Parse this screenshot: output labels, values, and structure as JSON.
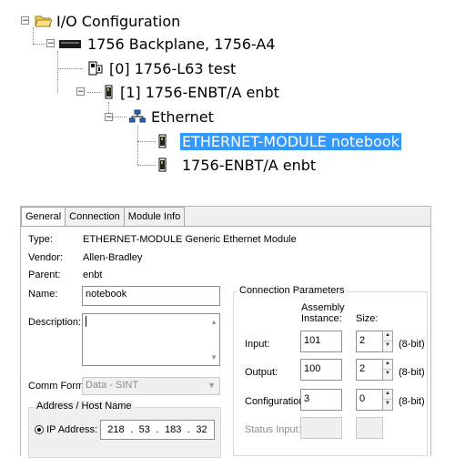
{
  "tree": {
    "root_label": "I/O Configuration",
    "backplane_label": "1756 Backplane, 1756-A4",
    "slot0_label": "[0] 1756-L63 test",
    "slot1_label": "[1] 1756-ENBT/A enbt",
    "ethernet_label": "Ethernet",
    "selected_module_label": "ETHERNET-MODULE notebook",
    "enbt_module_label": "1756-ENBT/A enbt",
    "selection_color": "#3399ff"
  },
  "dialog": {
    "tabs": [
      "General",
      "Connection",
      "Module Info"
    ],
    "active_tab": "General",
    "type_label": "Type:",
    "type_value": "ETHERNET-MODULE Generic Ethernet Module",
    "vendor_label": "Vendor:",
    "vendor_value": "Allen-Bradley",
    "parent_label": "Parent:",
    "parent_value": "enbt",
    "name_label": "Name:",
    "name_value": "notebook",
    "description_label": "Description:",
    "description_value": "",
    "comm_format_label": "Comm Format:",
    "comm_format_value": "Data - SINT",
    "address_group_title": "Address / Host Name",
    "ip_address_label": "IP Address:",
    "ip_octets": [
      "218",
      "53",
      "183",
      "32"
    ],
    "conn_params": {
      "title": "Connection Parameters",
      "assembly_header_1": "Assembly",
      "assembly_header_2": "Instance:",
      "size_header": "Size:",
      "input_label": "Input:",
      "input_instance": "101",
      "input_size": "2",
      "output_label": "Output:",
      "output_instance": "100",
      "output_size": "2",
      "config_label": "Configuration:",
      "config_instance": "3",
      "config_size": "0",
      "status_input_label": "Status Input:",
      "unit_8bit": "(8-bit)"
    }
  }
}
